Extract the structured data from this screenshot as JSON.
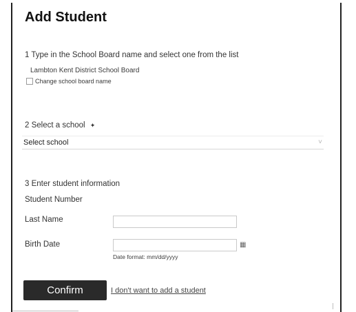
{
  "form": {
    "title": "Add Student",
    "step1": {
      "label": "1  Type in the School Board name and select one from the list",
      "selected_board": "Lambton Kent District School Board",
      "change_label": "Change school board name"
    },
    "step2": {
      "label": "2  Select a school",
      "select_value": "Select school"
    },
    "step3": {
      "label": "3  Enter student information",
      "student_number_label": "Student Number",
      "last_name_label": "Last Name",
      "last_name_value": "",
      "birth_date_label": "Birth Date",
      "birth_date_value": "",
      "date_format_hint": "Date format: mm/dd/yyyy"
    },
    "actions": {
      "confirm_label": "Confirm",
      "cancel_label": "I don't want to add a student"
    }
  },
  "icons": {
    "help": "help-icon",
    "dropdown": "chevron-down-icon",
    "calendar": "calendar-icon"
  }
}
